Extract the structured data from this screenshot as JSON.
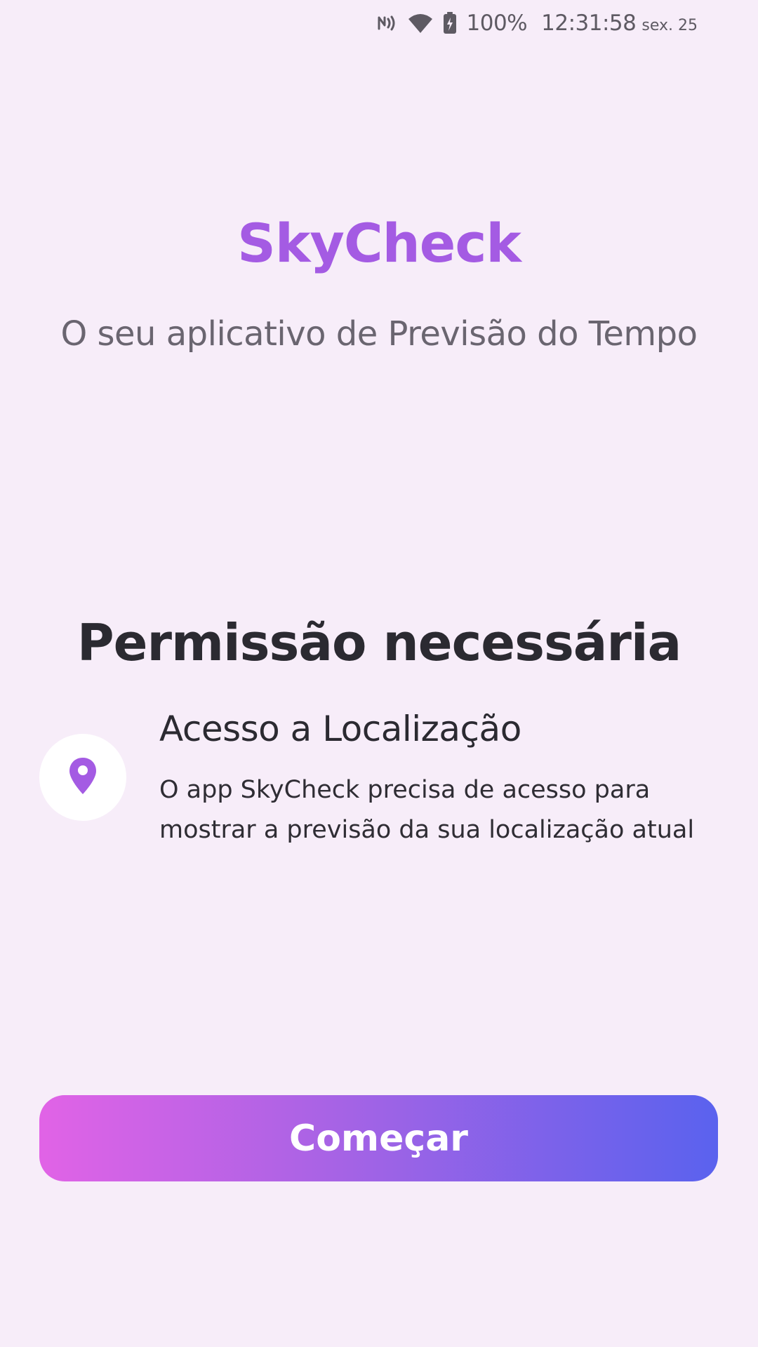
{
  "status_bar": {
    "icons": [
      "nfc-icon",
      "wifi-icon",
      "battery-charging-icon"
    ],
    "battery": "100%",
    "time": "12:31:58",
    "date": "sex. 25"
  },
  "header": {
    "title": "SkyCheck",
    "subtitle": "O seu aplicativo de Previsão do Tempo"
  },
  "permission": {
    "heading": "Permissão necessária",
    "icon": "location-pin-icon",
    "title": "Acesso a Localização",
    "description": "O app SkyCheck precisa de acesso para mostrar a previsão da sua localização atual"
  },
  "actions": {
    "start_label": "Começar"
  },
  "colors": {
    "background": "#F7EDF9",
    "accent": "#A45BE3",
    "button_gradient_start": "#E163E6",
    "button_gradient_end": "#5A62EE"
  }
}
